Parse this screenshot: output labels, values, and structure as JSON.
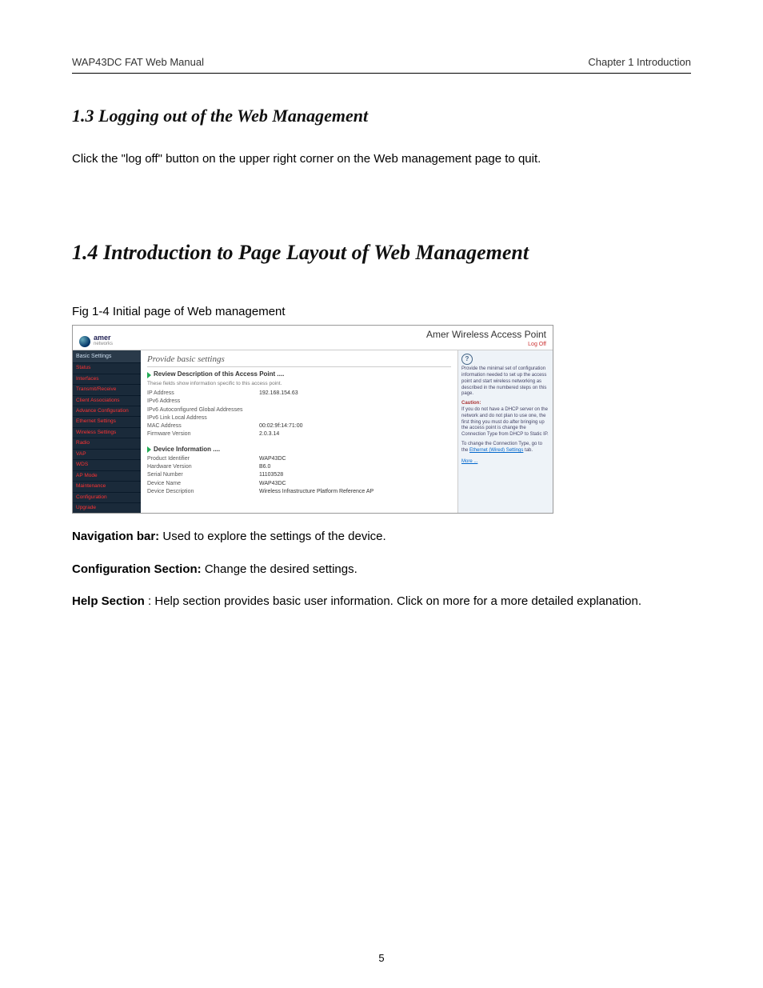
{
  "header": {
    "left": "WAP43DC FAT Web Manual",
    "right": "Chapter 1 Introduction"
  },
  "sections": {
    "s13_title": "1.3 Logging out of the Web Management",
    "s13_body": "Click the \"log off\" button on the upper right corner on the Web management page to quit.",
    "s14_title": "1.4 Introduction to Page Layout of Web Management",
    "fig_caption": "Fig 1-4 Initial page of Web management"
  },
  "screenshot": {
    "brand_top": "amer",
    "brand_sub": "networks",
    "product_title": "Amer Wireless Access Point",
    "logoff": "Log Off",
    "nav_header": "Basic Settings",
    "nav_items": [
      "Status",
      "Interfaces",
      "Transmit/Receive",
      "Client Associations",
      "Advance Configuration",
      "Ethernet Settings",
      "Wireless Settings",
      "Radio",
      "VAP",
      "WDS",
      "AP Mode",
      "Maintenance",
      "Configuration",
      "Upgrade"
    ],
    "main_title": "Provide basic settings",
    "block1_title": "Review Description of this Access Point ....",
    "block1_hint": "These fields show information specific to this access point.",
    "block1_rows": [
      {
        "k": "IP Address",
        "v": "192.168.154.63"
      },
      {
        "k": "IPv6 Address",
        "v": ""
      },
      {
        "k": "IPv6 Autoconfigured Global Addresses",
        "v": ""
      },
      {
        "k": "IPv6 Link Local Address",
        "v": ""
      },
      {
        "k": "MAC Address",
        "v": "00:02:9f:14:71:00"
      },
      {
        "k": "Firmware Version",
        "v": "2.0.3.14"
      }
    ],
    "block2_title": "Device Information ....",
    "block2_rows": [
      {
        "k": "Product Identifier",
        "v": "WAP43DC"
      },
      {
        "k": "Hardware Version",
        "v": "B6.0"
      },
      {
        "k": "Serial Number",
        "v": "11103528"
      },
      {
        "k": "Device Name",
        "v": "WAP43DC"
      },
      {
        "k": "Device Description",
        "v": "Wireless Infrastructure Platform Reference AP"
      }
    ],
    "help_intro": "Provide the minimal set of configuration information needed to set up the access point and start wireless networking as described in the numbered steps on this page.",
    "help_caution_label": "Caution:",
    "help_caution": "If you do not have a DHCP server on the network and do not plan to use one, the first thing you must do after bringing up the access point is change the Connection Type from DHCP to Static IP.",
    "help_change": "To change the Connection Type, go to the ",
    "help_link": "Ethernet (Wired) Settings",
    "help_tab": " tab.",
    "help_more": "More ..."
  },
  "annotations": {
    "nav_label": "Navigation bar:",
    "nav_text": "  Used to explore the settings of the device.",
    "conf_label": "Configuration Section:",
    "conf_text": " Change the desired settings.",
    "help_label": "Help Section",
    "help_text": ":  Help section provides basic user information. Click on more for a more detailed explanation."
  },
  "page_number": "5"
}
